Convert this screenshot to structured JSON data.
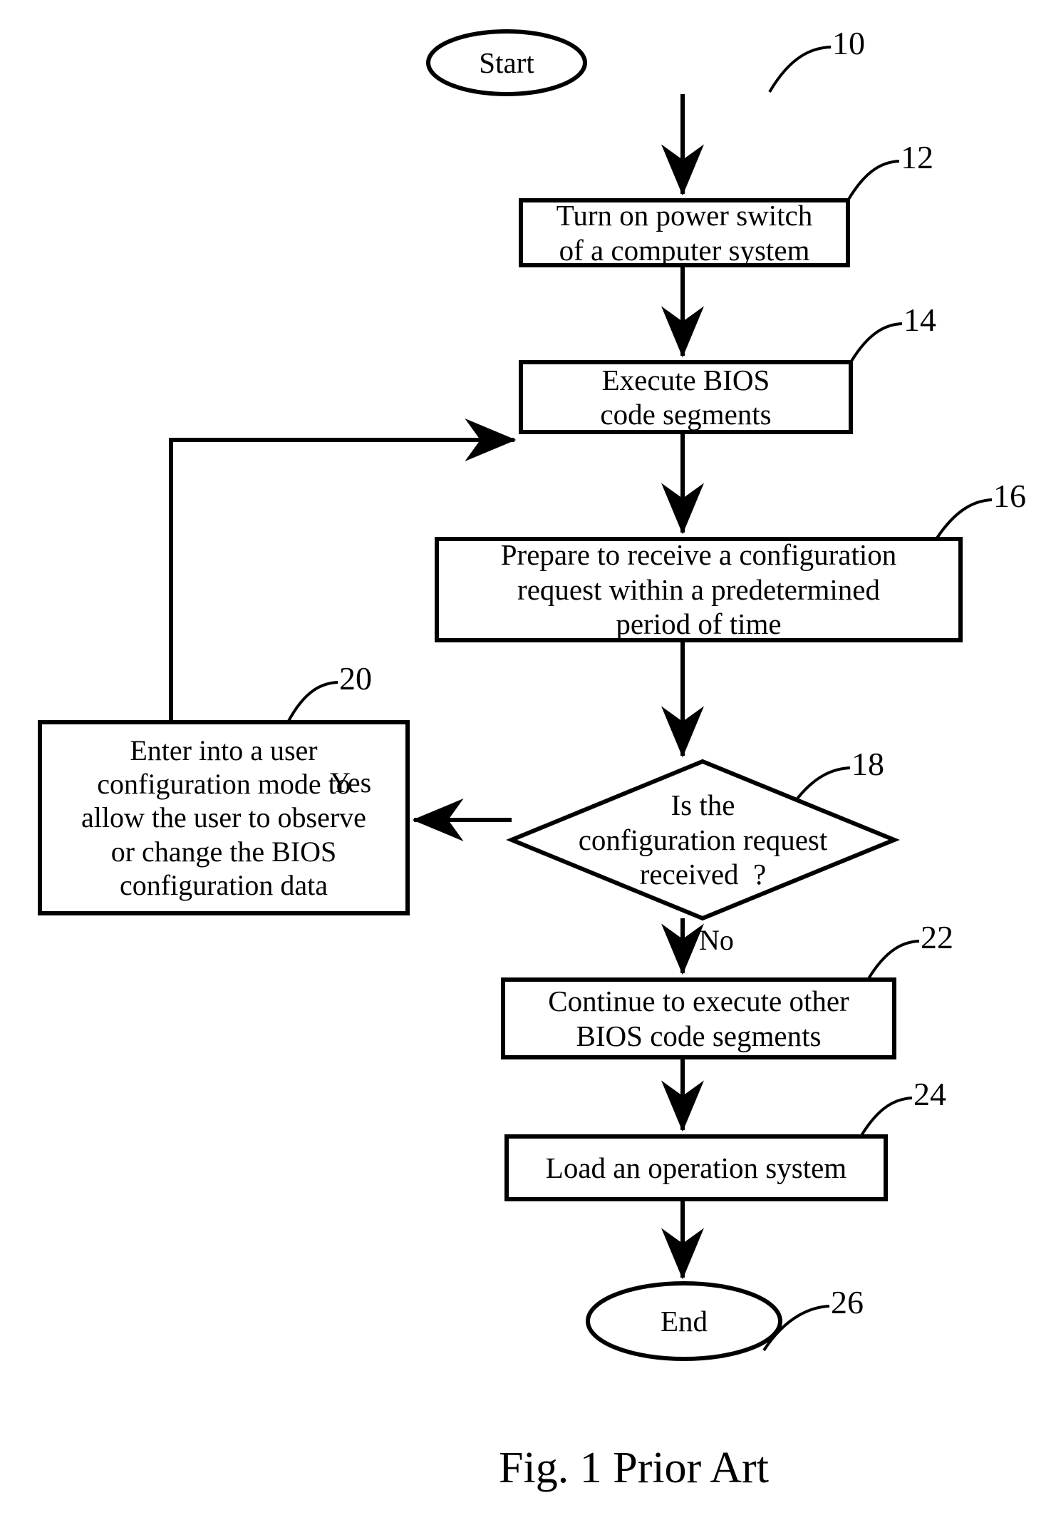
{
  "figure": {
    "caption": "Fig. 1 Prior Art",
    "stroke_color": "#000000",
    "background_color": "#ffffff"
  },
  "nodes": {
    "start": {
      "id": "10",
      "shape": "ellipse",
      "label": "Start"
    },
    "power_switch": {
      "id": "12",
      "shape": "rectangle",
      "line1": "Turn on power switch",
      "line2": "of a computer system"
    },
    "execute_bios": {
      "id": "14",
      "shape": "rectangle",
      "line1": "Execute BIOS",
      "line2": "code segments"
    },
    "prepare_receive": {
      "id": "16",
      "shape": "rectangle",
      "line1": "Prepare to receive a configuration",
      "line2": "request within a predetermined",
      "line3": "period of time"
    },
    "decision": {
      "id": "18",
      "shape": "diamond",
      "line1": "Is the",
      "line2": "configuration request",
      "line3": "received  ?"
    },
    "user_config": {
      "id": "20",
      "shape": "rectangle",
      "line1": "Enter into a user",
      "line2": "configuration mode to",
      "line3": "allow the user to observe",
      "line4": "or change the BIOS",
      "line5": "configuration data"
    },
    "continue_bios": {
      "id": "22",
      "shape": "rectangle",
      "line1": "Continue to execute other",
      "line2": "BIOS code segments"
    },
    "load_os": {
      "id": "24",
      "shape": "rectangle",
      "line1": "Load an operation system"
    },
    "end": {
      "id": "26",
      "shape": "ellipse",
      "label": "End"
    }
  },
  "edges": {
    "yes_label": "Yes",
    "no_label": "No"
  }
}
